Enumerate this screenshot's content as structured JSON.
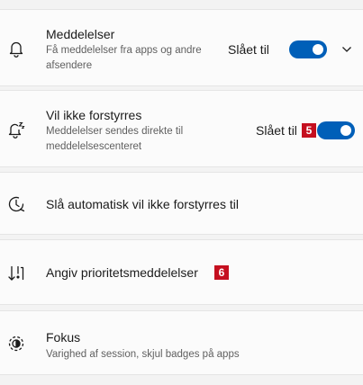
{
  "notifications": {
    "title": "Meddelelser",
    "description": "Få meddelelser fra apps og andre afsendere",
    "status": "Slået til",
    "toggle_on": true
  },
  "dnd": {
    "title": "Vil ikke forstyrres",
    "description": "Meddelelser sendes direkte til meddelelsescenteret",
    "status": "Slået til",
    "marker": "5",
    "toggle_on": true
  },
  "auto_dnd": {
    "title": "Slå automatisk vil ikke forstyrres til"
  },
  "priority": {
    "title": "Angiv prioritetsmeddelelser",
    "marker": "6"
  },
  "focus": {
    "title": "Fokus",
    "description": "Varighed af session, skjul badges på apps"
  },
  "colors": {
    "accent": "#005fb8",
    "marker": "#c50f1f",
    "card": "#fbfbfb",
    "background": "#f3f3f3"
  }
}
